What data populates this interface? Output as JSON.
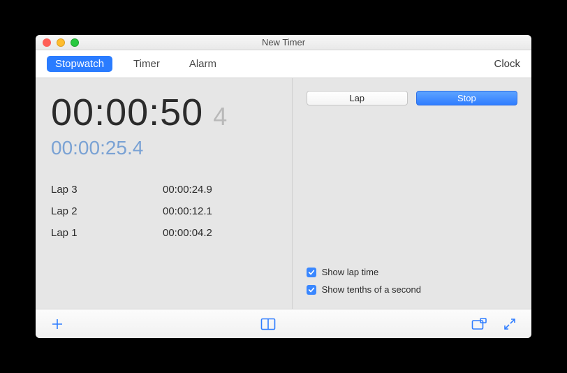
{
  "window": {
    "title": "New Timer"
  },
  "tabs": {
    "items": [
      "Stopwatch",
      "Timer",
      "Alarm"
    ],
    "active": 0,
    "right": "Clock"
  },
  "stopwatch": {
    "main_time": "00:00:50",
    "tenth": "4",
    "lap_time": "00:00:25.4",
    "laps": [
      {
        "label": "Lap 3",
        "value": "00:00:24.9"
      },
      {
        "label": "Lap 2",
        "value": "00:00:12.1"
      },
      {
        "label": "Lap 1",
        "value": "00:00:04.2"
      }
    ]
  },
  "controls": {
    "lap_button": "Lap",
    "stop_button": "Stop",
    "show_lap_label": "Show lap time",
    "show_tenths_label": "Show tenths of a second",
    "show_lap_checked": true,
    "show_tenths_checked": true
  },
  "colors": {
    "accent": "#2f7dff"
  }
}
